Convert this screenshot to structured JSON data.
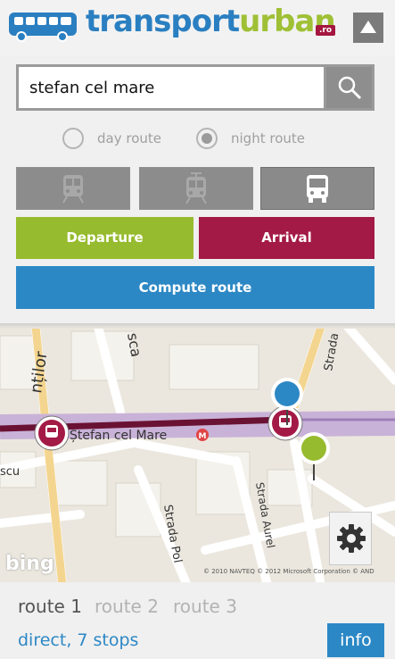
{
  "header": {
    "logo_transport": "transport",
    "logo_urban": "urban",
    "logo_domain": ".ro"
  },
  "search": {
    "value": "stefan cel mare",
    "placeholder": ""
  },
  "route_type": {
    "options": [
      {
        "label": "day route",
        "selected": false
      },
      {
        "label": "night route",
        "selected": true
      }
    ]
  },
  "transport_modes": [
    {
      "name": "metro-icon",
      "active": false
    },
    {
      "name": "tram-icon",
      "active": false
    },
    {
      "name": "bus-icon",
      "active": true
    }
  ],
  "actions": {
    "departure": "Departure",
    "arrival": "Arrival",
    "compute": "Compute route"
  },
  "map": {
    "street_labels": [
      "Ștefan cel Mare",
      "Strada Pol",
      "Strada Aurel",
      "Strada",
      "sca",
      "nților",
      "scu"
    ],
    "metro_badge": "M",
    "bing": "bing",
    "copyright": "© 2010 NAVTEQ  © 2012 Microsoft Corporation  © AND"
  },
  "routes": {
    "tabs": [
      "route 1",
      "route 2",
      "route 3"
    ],
    "active_index": 0,
    "summary": "direct, 7 stops",
    "info_label": "info"
  },
  "colors": {
    "departure": "#97bb2e",
    "arrival": "#a31a46",
    "accent": "#2c88c5",
    "route_line": "#6a1233"
  }
}
